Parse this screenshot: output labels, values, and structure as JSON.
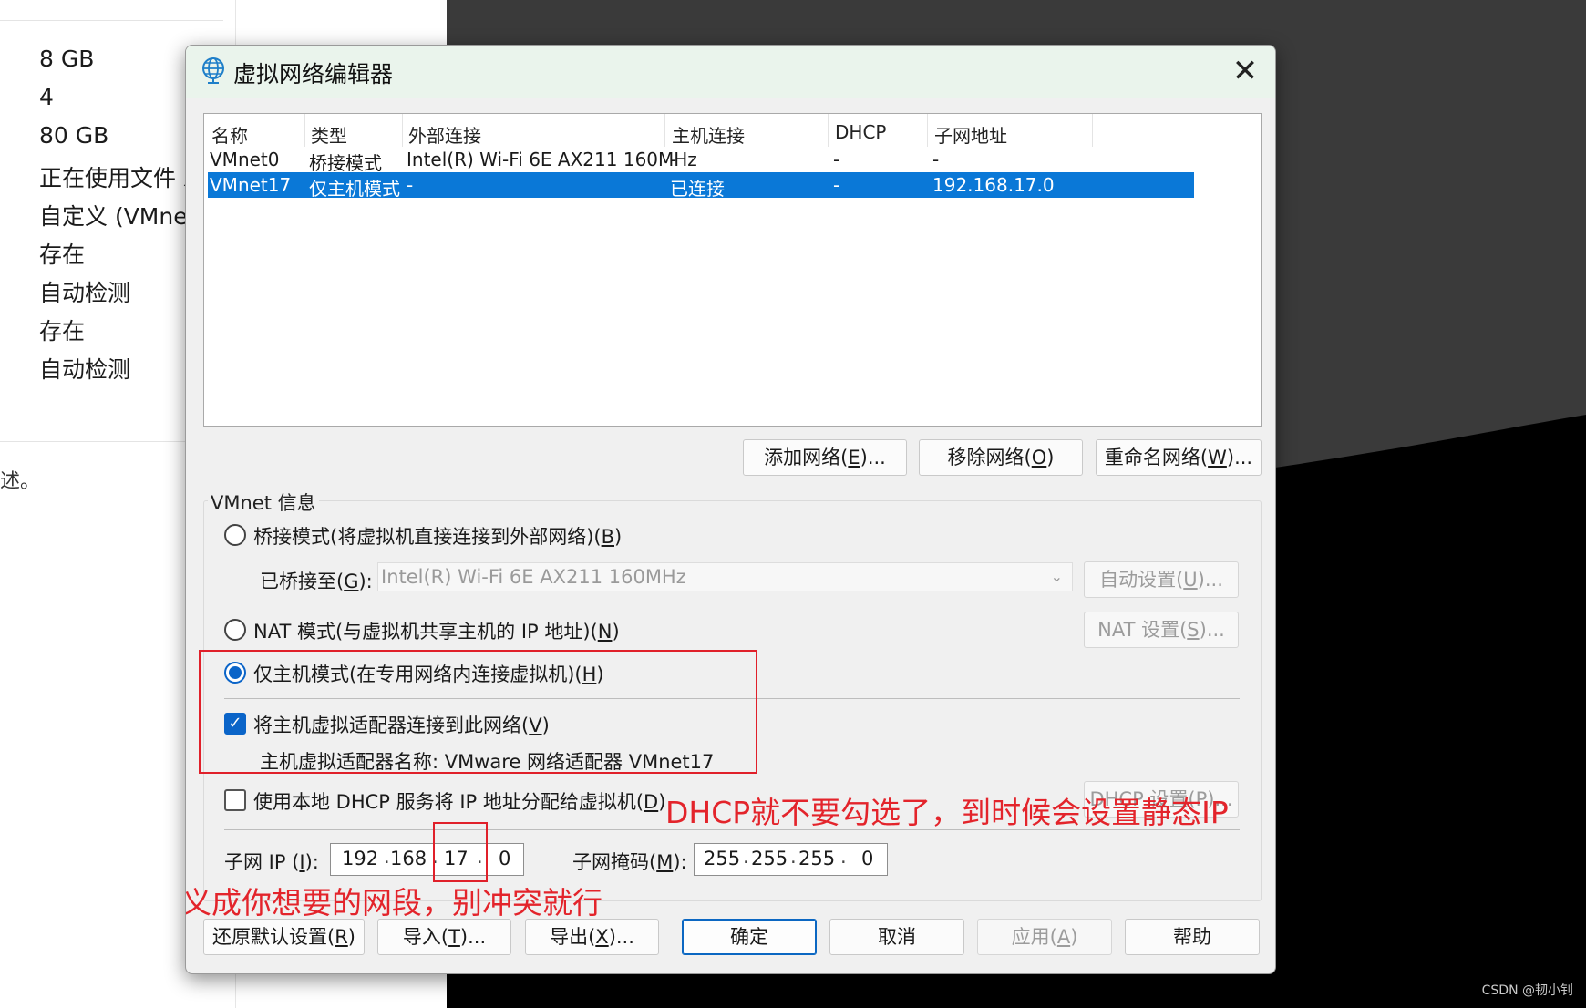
{
  "background": {
    "values": [
      "8 GB",
      "4",
      "80 GB",
      "正在使用文件 X",
      "自定义 (VMnet",
      "存在",
      "自动检测",
      "存在",
      "自动检测"
    ],
    "desc_fragment": "述。"
  },
  "dialog": {
    "title": "虚拟网络编辑器",
    "close": "✕",
    "table": {
      "headers": [
        "名称",
        "类型",
        "外部连接",
        "主机连接",
        "DHCP",
        "子网地址"
      ],
      "rows": [
        [
          "VMnet0",
          "桥接模式",
          "Intel(R) Wi-Fi 6E AX211 160MHz",
          "-",
          "-",
          "-"
        ],
        [
          "VMnet17",
          "仅主机模式",
          "-",
          "已连接",
          "-",
          "192.168.17.0"
        ]
      ],
      "selected_row": 1
    },
    "buttons": {
      "add_prefix": "添加网络(",
      "add_key": "E",
      "add_suffix": ")...",
      "remove_prefix": "移除网络(",
      "remove_key": "O",
      "remove_suffix": ")",
      "rename_prefix": "重命名网络(",
      "rename_key": "W",
      "rename_suffix": ")..."
    },
    "info": {
      "group_label": "VMnet 信息",
      "bridge_prefix": "桥接模式(将虚拟机直接连接到外部网络)(",
      "bridge_key": "B",
      "bridge_suffix": ")",
      "bridged_to_prefix": "已桥接至(",
      "bridged_to_key": "G",
      "bridged_to_suffix": "):",
      "bridged_to_value": "Intel(R) Wi-Fi 6E AX211 160MHz",
      "auto_prefix": "自动设置(",
      "auto_key": "U",
      "auto_suffix": ")...",
      "nat_prefix": "NAT 模式(与虚拟机共享主机的 IP 地址)(",
      "nat_key": "N",
      "nat_suffix": ")",
      "nat_settings_prefix": "NAT 设置(",
      "nat_settings_key": "S",
      "nat_settings_suffix": ")...",
      "hostonly_prefix": "仅主机模式(在专用网络内连接虚拟机)(",
      "hostonly_key": "H",
      "hostonly_suffix": ")",
      "connect_prefix": "将主机虚拟适配器连接到此网络(",
      "connect_key": "V",
      "connect_suffix": ")",
      "adapter_name": "主机虚拟适配器名称: VMware 网络适配器 VMnet17",
      "dhcp_prefix": "使用本地 DHCP 服务将 IP 地址分配给虚拟机(",
      "dhcp_key": "D",
      "dhcp_suffix": ")",
      "dhcp_settings": "DHCP 设置(P)...",
      "subnet_ip_prefix": "子网 IP (",
      "subnet_ip_key": "I",
      "subnet_ip_suffix": "):",
      "subnet_ip": [
        "192",
        "168",
        "17",
        "0"
      ],
      "subnet_mask_prefix": "子网掩码(",
      "subnet_mask_key": "M",
      "subnet_mask_suffix": "):",
      "subnet_mask": [
        "255",
        "255",
        "255",
        "0"
      ]
    },
    "footer": {
      "restore_prefix": "还原默认设置(",
      "restore_key": "R",
      "restore_suffix": ")",
      "import_prefix": "导入(",
      "import_key": "T",
      "import_suffix": ")...",
      "export_prefix": "导出(",
      "export_key": "X",
      "export_suffix": ")...",
      "ok": "确定",
      "cancel": "取消",
      "apply_prefix": "应用(",
      "apply_key": "A",
      "apply_suffix": ")",
      "help": "帮助"
    }
  },
  "annotations": {
    "dhcp_note": "DHCP就不要勾选了，到时候会设置静态IP",
    "subnet_note": "同意自定义成你想要的网段，别冲突就行"
  },
  "watermark": "CSDN @韧小钊",
  "colors": {
    "selection": "#0a78d7",
    "annotation": "#e3242b",
    "accent": "#0a64c8"
  }
}
